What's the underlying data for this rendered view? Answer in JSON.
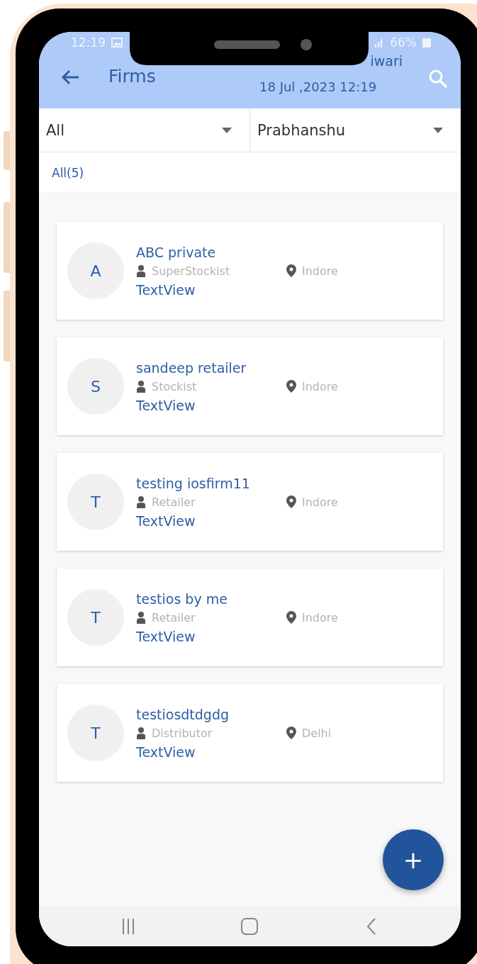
{
  "status_bar": {
    "time": "12:19",
    "battery": "66%"
  },
  "header": {
    "title": "Firms",
    "user": "iwari",
    "datetime": "18 Jul ,2023 12:19"
  },
  "filters": [
    {
      "value": "All"
    },
    {
      "value": "Prabhanshu"
    }
  ],
  "tabs": [
    {
      "label": "All(5)",
      "selected": true
    }
  ],
  "firms": [
    {
      "initial": "A",
      "name": "ABC private",
      "type": "SuperStockist",
      "city": "Indore",
      "extra": "TextView"
    },
    {
      "initial": "S",
      "name": "sandeep retailer",
      "type": "Stockist",
      "city": "Indore",
      "extra": "TextView"
    },
    {
      "initial": "T",
      "name": "testing iosfirm11",
      "type": "Retailer",
      "city": "Indore",
      "extra": "TextView"
    },
    {
      "initial": "T",
      "name": "testios by me",
      "type": "Retailer",
      "city": "Indore",
      "extra": "TextView"
    },
    {
      "initial": "T",
      "name": "testiosdtdgdg",
      "type": "Distributor",
      "city": "Delhi",
      "extra": "TextView"
    }
  ],
  "fab": {
    "label": "+"
  }
}
